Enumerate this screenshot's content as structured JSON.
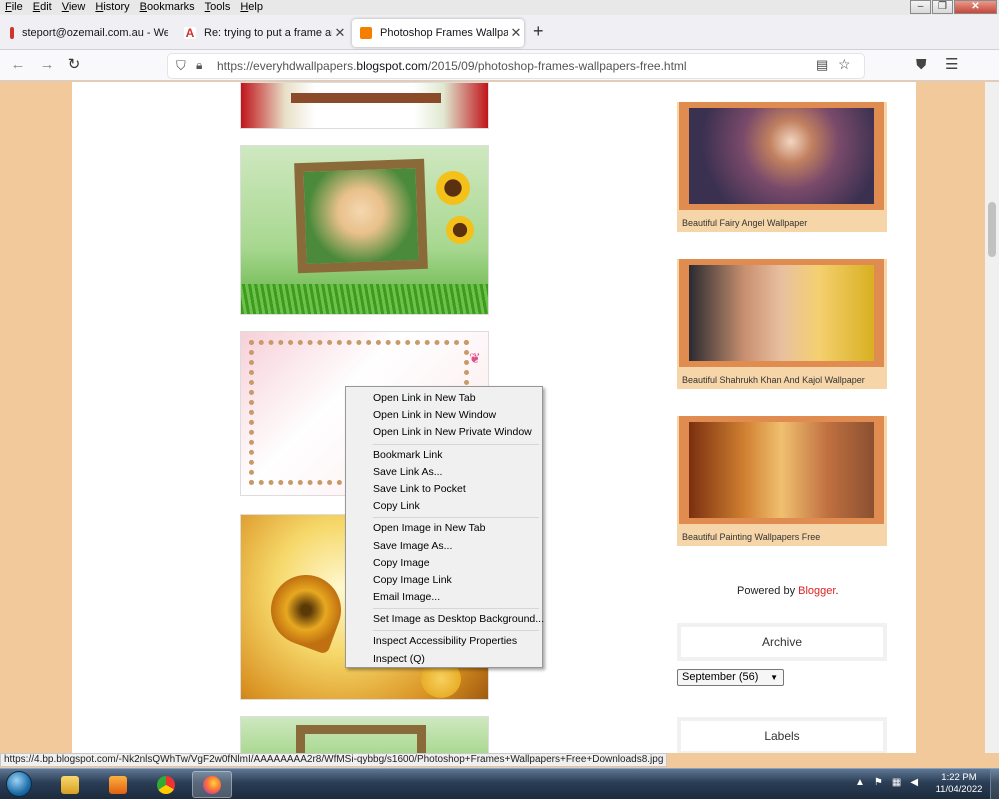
{
  "menubar": {
    "items": [
      "File",
      "Edit",
      "View",
      "History",
      "Bookmarks",
      "Tools",
      "Help"
    ],
    "access_keys": [
      "F",
      "E",
      "V",
      "H",
      "B",
      "T",
      "H"
    ]
  },
  "window_buttons": {
    "minimize": "–",
    "restore": "❐",
    "close": "✕"
  },
  "tabs": [
    {
      "title": "steport@ozemail.com.au - Web",
      "favicon_color": "#d0342c"
    },
    {
      "title": "Re: trying to put a frame around",
      "favicon_color": "#d0342c"
    },
    {
      "title": "Photoshop Frames Wallpapers F",
      "favicon_color": "#f57d00",
      "active": true
    }
  ],
  "new_tab_label": "+",
  "nav": {
    "url_prefix": "https://everyhdwallpapers.",
    "url_host": "blogspot.com",
    "url_path": "/2015/09/photoshop-frames-wallpapers-free.html"
  },
  "sidebar": {
    "cards": [
      {
        "caption": "Beautiful Fairy Angel Wallpaper"
      },
      {
        "caption": "Beautiful Shahrukh Khan And Kajol Wallpaper"
      },
      {
        "caption": "Beautiful Painting Wallpapers Free"
      }
    ],
    "powered_prefix": "Powered by ",
    "powered_link": "Blogger",
    "powered_suffix": ".",
    "archive_title": "Archive",
    "archive_selected": "September (56)",
    "labels_title": "Labels"
  },
  "context_menu": {
    "groups": [
      [
        "Open Link in New Tab",
        "Open Link in New Window",
        "Open Link in New Private Window"
      ],
      [
        "Bookmark Link",
        "Save Link As...",
        "Save Link to Pocket",
        "Copy Link"
      ],
      [
        "Open Image in New Tab",
        "Save Image As...",
        "Copy Image",
        "Copy Image Link",
        "Email Image..."
      ],
      [
        "Set Image as Desktop Background..."
      ],
      [
        "Inspect Accessibility Properties",
        "Inspect (Q)"
      ]
    ]
  },
  "status_url": "https://4.bp.blogspot.com/-Nk2nlsQWhTw/VgF2w0fNlmI/AAAAAAAA2r8/WfMSi-qybbg/s1600/Photoshop+Frames+Wallpapers+Free+Downloads8.jpg",
  "taskbar": {
    "time": "1:22 PM",
    "date": "11/04/2022"
  }
}
